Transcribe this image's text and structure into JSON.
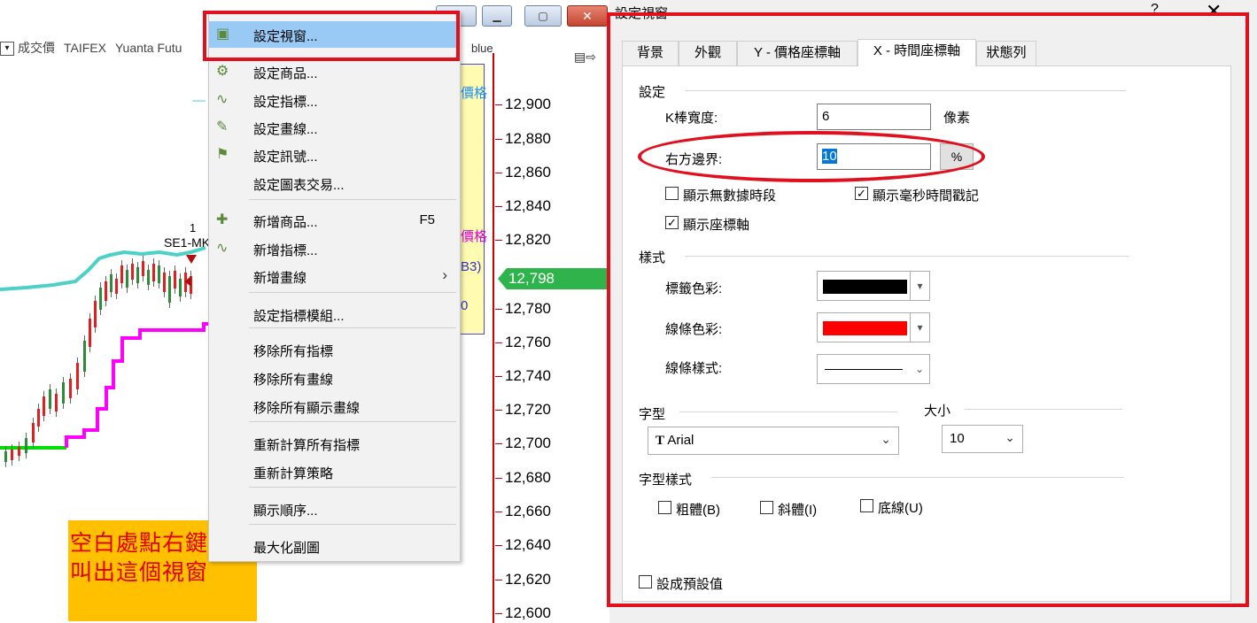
{
  "chart": {
    "symbol_line": [
      "成交價",
      "TAIFEX",
      "Yuanta Futu"
    ],
    "partial_header": "blue",
    "marker_number": "1",
    "marker_label": "SE1-MK",
    "info_texts": [
      "價格",
      "價格",
      "B3)",
      "0"
    ],
    "price_axis": [
      "12,900",
      "12,880",
      "12,860",
      "12,840",
      "12,820",
      "12,780",
      "12,760",
      "12,740",
      "12,720",
      "12,700",
      "12,680",
      "12,660",
      "12,640",
      "12,620",
      "12,600"
    ],
    "current_price": "12,798",
    "colors": {
      "upper_band": "#4dd0c8",
      "lower_band": "#ff00ff",
      "support": "#00dd00",
      "candle_up": "#e02020",
      "candle_down": "#2e8b3a",
      "price_tag": "#2fb44b"
    }
  },
  "annotation": {
    "line1": "空白處點右鍵",
    "line2": "叫出這個視窗"
  },
  "context_menu": {
    "items": [
      {
        "label": "設定視窗...",
        "icon": "window-settings-icon",
        "highlighted": true
      },
      {
        "label": "設定商品...",
        "icon": "symbol-settings-icon"
      },
      {
        "label": "設定指標...",
        "icon": "indicator-settings-icon"
      },
      {
        "label": "設定畫線...",
        "icon": "drawing-settings-icon"
      },
      {
        "label": "設定訊號...",
        "icon": "signal-settings-icon"
      },
      {
        "label": "設定圖表交易..."
      },
      {
        "label": "新增商品...",
        "shortcut": "F5",
        "icon": "add-symbol-icon"
      },
      {
        "label": "新增指標...",
        "icon": "add-indicator-icon"
      },
      {
        "label": "新增畫線",
        "submenu": "›"
      },
      {
        "label": "設定指標模組..."
      },
      {
        "label": "移除所有指標"
      },
      {
        "label": "移除所有畫線"
      },
      {
        "label": "移除所有顯示畫線"
      },
      {
        "label": "重新計算所有指標"
      },
      {
        "label": "重新計算策略"
      },
      {
        "label": "顯示順序..."
      },
      {
        "label": "最大化副圖"
      }
    ]
  },
  "dialog": {
    "title": "設定視窗",
    "help": "?",
    "close": "✕",
    "tabs": [
      "背景",
      "外觀",
      "Y - 價格座標軸",
      "X - 時間座標軸",
      "狀態列"
    ],
    "active_tab": "X - 時間座標軸",
    "settings_group": "設定",
    "bar_width_label": "K棒寬度:",
    "bar_width_value": "6",
    "bar_width_unit": "像素",
    "right_margin_label": "右方邊界:",
    "right_margin_value": "10",
    "right_margin_unit": "%",
    "cb_show_no_data": "顯示無數據時段",
    "cb_show_no_data_checked": false,
    "cb_show_ms": "顯示毫秒時間戳記",
    "cb_show_ms_checked": true,
    "cb_show_axis": "顯示座標軸",
    "cb_show_axis_checked": true,
    "style_group": "樣式",
    "label_color_label": "標籤色彩:",
    "label_color": "#000000",
    "line_color_label": "線條色彩:",
    "line_color": "#ff0000",
    "line_style_label": "線條樣式:",
    "font_group": "字型",
    "size_group": "大小",
    "font_value": "Arial",
    "font_icon": "truetype-icon",
    "size_value": "10",
    "font_style_group": "字型樣式",
    "cb_bold": "粗體(B)",
    "cb_italic": "斜體(I)",
    "cb_underline": "底線(U)",
    "cb_default": "設成預設值"
  }
}
